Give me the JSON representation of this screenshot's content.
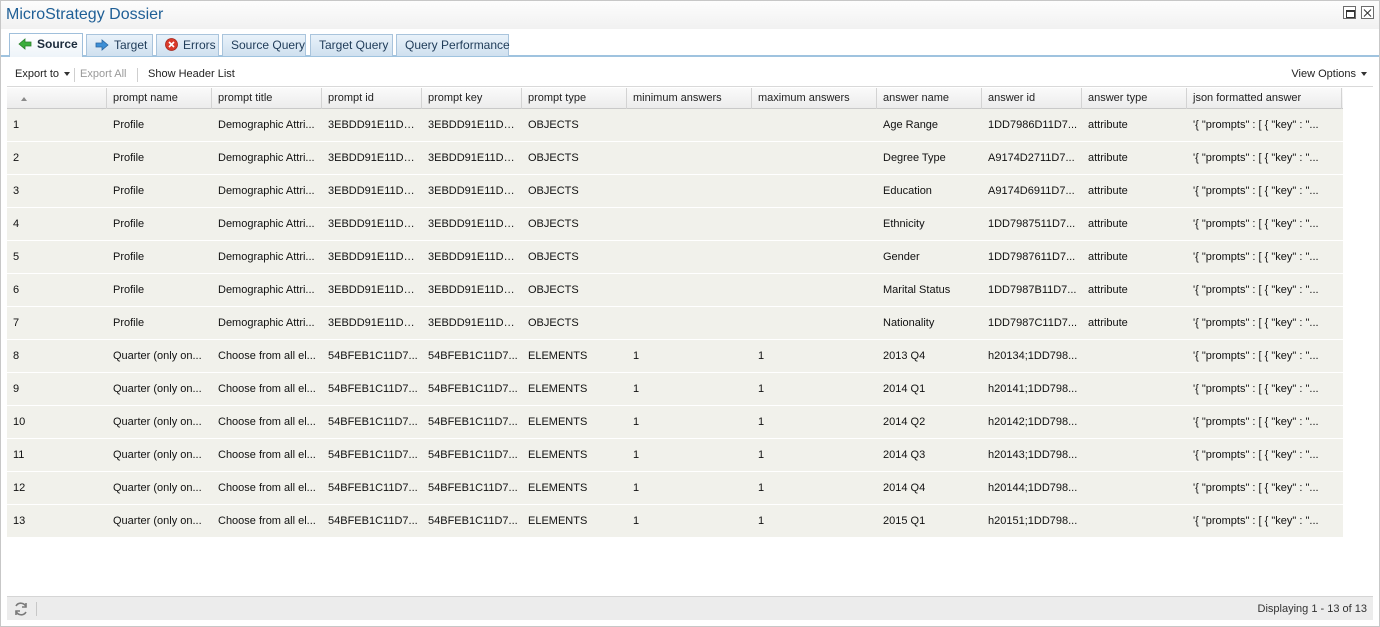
{
  "window": {
    "title": "MicroStrategy Dossier"
  },
  "tabs": [
    {
      "label": "Source",
      "icon": "arrow-left-green-icon",
      "active": true
    },
    {
      "label": "Target",
      "icon": "arrow-right-blue-icon",
      "active": false
    },
    {
      "label": "Errors",
      "icon": "error-red-icon",
      "active": false
    },
    {
      "label": "Source Query",
      "active": false
    },
    {
      "label": "Target Query",
      "active": false
    },
    {
      "label": "Query Performance",
      "active": false
    }
  ],
  "toolbar": {
    "export_to": "Export to",
    "export_all": "Export All",
    "show_header_list": "Show Header List",
    "view_options": "View Options"
  },
  "grid": {
    "columns": [
      "",
      "prompt name",
      "prompt title",
      "prompt id",
      "prompt key",
      "prompt type",
      "minimum answers",
      "maximum answers",
      "answer name",
      "answer id",
      "answer type",
      "json formatted answer"
    ],
    "rows": [
      [
        "1",
        "Profile",
        "Demographic Attri...",
        "3EBDD91E11D7...",
        "3EBDD91E11D7...",
        "OBJECTS",
        "",
        "",
        "Age Range",
        "1DD7986D11D7...",
        "attribute",
        "'{   \"prompts\" : [ {     \"key\" : \"..."
      ],
      [
        "2",
        "Profile",
        "Demographic Attri...",
        "3EBDD91E11D7...",
        "3EBDD91E11D7...",
        "OBJECTS",
        "",
        "",
        "Degree Type",
        "A9174D2711D7...",
        "attribute",
        "'{   \"prompts\" : [ {     \"key\" : \"..."
      ],
      [
        "3",
        "Profile",
        "Demographic Attri...",
        "3EBDD91E11D7...",
        "3EBDD91E11D7...",
        "OBJECTS",
        "",
        "",
        "Education",
        "A9174D6911D7...",
        "attribute",
        "'{   \"prompts\" : [ {     \"key\" : \"..."
      ],
      [
        "4",
        "Profile",
        "Demographic Attri...",
        "3EBDD91E11D7...",
        "3EBDD91E11D7...",
        "OBJECTS",
        "",
        "",
        "Ethnicity",
        "1DD7987511D7...",
        "attribute",
        "'{   \"prompts\" : [ {     \"key\" : \"..."
      ],
      [
        "5",
        "Profile",
        "Demographic Attri...",
        "3EBDD91E11D7...",
        "3EBDD91E11D7...",
        "OBJECTS",
        "",
        "",
        "Gender",
        "1DD7987611D7...",
        "attribute",
        "'{   \"prompts\" : [ {     \"key\" : \"..."
      ],
      [
        "6",
        "Profile",
        "Demographic Attri...",
        "3EBDD91E11D7...",
        "3EBDD91E11D7...",
        "OBJECTS",
        "",
        "",
        "Marital Status",
        "1DD7987B11D7...",
        "attribute",
        "'{   \"prompts\" : [ {     \"key\" : \"..."
      ],
      [
        "7",
        "Profile",
        "Demographic Attri...",
        "3EBDD91E11D7...",
        "3EBDD91E11D7...",
        "OBJECTS",
        "",
        "",
        "Nationality",
        "1DD7987C11D7...",
        "attribute",
        "'{   \"prompts\" : [ {     \"key\" : \"..."
      ],
      [
        "8",
        "Quarter (only on...",
        "Choose from all el...",
        "54BFEB1C11D7...",
        "54BFEB1C11D7...",
        "ELEMENTS",
        "1",
        "1",
        "2013 Q4",
        "h20134;1DD798...",
        "",
        "'{   \"prompts\" : [ {     \"key\" : \"..."
      ],
      [
        "9",
        "Quarter (only on...",
        "Choose from all el...",
        "54BFEB1C11D7...",
        "54BFEB1C11D7...",
        "ELEMENTS",
        "1",
        "1",
        "2014 Q1",
        "h20141;1DD798...",
        "",
        "'{   \"prompts\" : [ {     \"key\" : \"..."
      ],
      [
        "10",
        "Quarter (only on...",
        "Choose from all el...",
        "54BFEB1C11D7...",
        "54BFEB1C11D7...",
        "ELEMENTS",
        "1",
        "1",
        "2014 Q2",
        "h20142;1DD798...",
        "",
        "'{   \"prompts\" : [ {     \"key\" : \"..."
      ],
      [
        "11",
        "Quarter (only on...",
        "Choose from all el...",
        "54BFEB1C11D7...",
        "54BFEB1C11D7...",
        "ELEMENTS",
        "1",
        "1",
        "2014 Q3",
        "h20143;1DD798...",
        "",
        "'{   \"prompts\" : [ {     \"key\" : \"..."
      ],
      [
        "12",
        "Quarter (only on...",
        "Choose from all el...",
        "54BFEB1C11D7...",
        "54BFEB1C11D7...",
        "ELEMENTS",
        "1",
        "1",
        "2014 Q4",
        "h20144;1DD798...",
        "",
        "'{   \"prompts\" : [ {     \"key\" : \"..."
      ],
      [
        "13",
        "Quarter (only on...",
        "Choose from all el...",
        "54BFEB1C11D7...",
        "54BFEB1C11D7...",
        "ELEMENTS",
        "1",
        "1",
        "2015 Q1",
        "h20151;1DD798...",
        "",
        "'{   \"prompts\" : [ {     \"key\" : \"..."
      ]
    ]
  },
  "status": {
    "text": "Displaying 1 - 13 of 13",
    "refresh_icon": "refresh-icon"
  },
  "colors": {
    "title": "#1f5f96",
    "row_bg": "#f1f1eb",
    "tab_border": "#9fc3df"
  }
}
